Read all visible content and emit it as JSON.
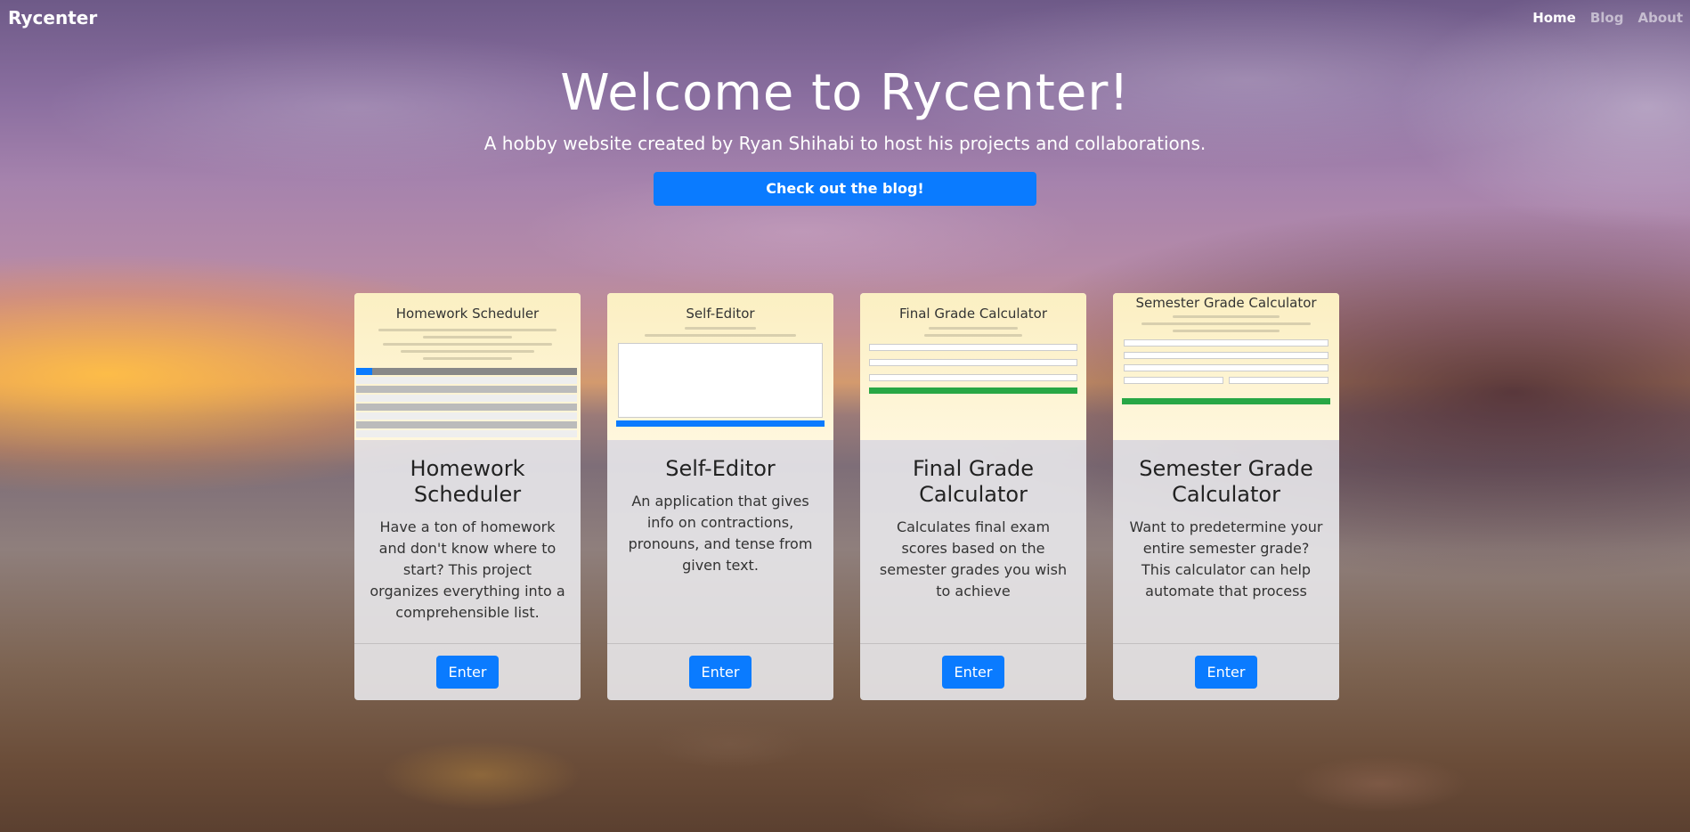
{
  "nav": {
    "brand": "Rycenter",
    "links": [
      {
        "label": "Home",
        "active": true
      },
      {
        "label": "Blog",
        "active": false
      },
      {
        "label": "About",
        "active": false
      }
    ]
  },
  "hero": {
    "title": "Welcome to Rycenter!",
    "subtitle": "A hobby website created by Ryan Shihabi to host his projects and collaborations.",
    "button": "Check out the blog!"
  },
  "cards": [
    {
      "thumb_title": "Homework Scheduler",
      "title": "Homework Scheduler",
      "text": "Have a ton of homework and don't know where to start? This project organizes everything into a comprehensible list.",
      "button": "Enter"
    },
    {
      "thumb_title": "Self-Editor",
      "title": "Self-Editor",
      "text": "An application that gives info on contractions, pronouns, and tense from given text.",
      "button": "Enter"
    },
    {
      "thumb_title": "Final Grade Calculator",
      "title": "Final Grade Calculator",
      "text": "Calculates final exam scores based on the semester grades you wish to achieve",
      "button": "Enter"
    },
    {
      "thumb_title": "Semester Grade Calculator",
      "title": "Semester Grade Calculator",
      "text": "Want to predetermine your entire semester grade? This calculator can help automate that process",
      "button": "Enter"
    }
  ],
  "colors": {
    "primary": "#0a7bff",
    "success": "#28a745"
  }
}
